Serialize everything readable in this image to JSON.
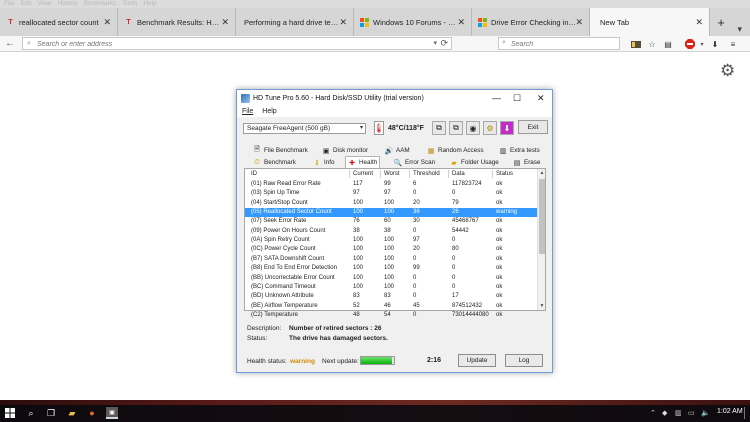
{
  "browser": {
    "menu": [
      "File",
      "Edit",
      "View",
      "History",
      "Bookmarks",
      "Tools",
      "Help"
    ],
    "tabs": [
      {
        "label": "reallocated sector count",
        "favicon": "T",
        "color": "#d9261c"
      },
      {
        "label": "Benchmark Results: HD T...",
        "favicon": "T",
        "color": "#d9261c"
      },
      {
        "label": "Performing a hard drive test w...",
        "favicon": "",
        "color": "#888888"
      },
      {
        "label": "Windows 10 Forums - Sea...",
        "favicon": "win",
        "color": "#1e73be"
      },
      {
        "label": "Drive Error Checking in Wi...",
        "favicon": "win",
        "color": "#1e73be"
      },
      {
        "label": "New Tab",
        "favicon": "",
        "color": "#ffffff"
      }
    ],
    "address_placeholder": "Search or enter address",
    "search_placeholder": "Search"
  },
  "window": {
    "title": "HD Tune Pro 5.60 - Hard Disk/SSD Utility (trial version)",
    "menu": [
      "File",
      "Help"
    ],
    "drive": "Seagate FreeAgent (500 gB)",
    "temperature": "48°C/118°F",
    "exit_label": "Exit",
    "tabs_row1": [
      "File Benchmark",
      "Disk monitor",
      "AAM",
      "Random Access",
      "Extra tests"
    ],
    "tabs_row2": [
      "Benchmark",
      "Info",
      "Health",
      "Error Scan",
      "Folder Usage",
      "Erase"
    ],
    "selected_tab": "Health",
    "table": {
      "headers": [
        "ID",
        "Current",
        "Worst",
        "Threshold",
        "Data",
        "Status"
      ],
      "rows": [
        [
          "(01) Raw Read Error Rate",
          "117",
          "99",
          "6",
          "117823724",
          "ok"
        ],
        [
          "(03) Spin Up Time",
          "97",
          "97",
          "0",
          "0",
          "ok"
        ],
        [
          "(04) Start/Stop Count",
          "100",
          "100",
          "20",
          "79",
          "ok"
        ],
        [
          "(05) Reallocated Sector Count",
          "100",
          "100",
          "36",
          "26",
          "warning"
        ],
        [
          "(07) Seek Error Rate",
          "76",
          "60",
          "30",
          "45468767",
          "ok"
        ],
        [
          "(09) Power On Hours Count",
          "38",
          "38",
          "0",
          "54442",
          "ok"
        ],
        [
          "(0A) Spin Retry Count",
          "100",
          "100",
          "97",
          "0",
          "ok"
        ],
        [
          "(0C) Power Cycle Count",
          "100",
          "100",
          "20",
          "80",
          "ok"
        ],
        [
          "(B7) SATA Downshift Count",
          "100",
          "100",
          "0",
          "0",
          "ok"
        ],
        [
          "(B8) End To End Error Detection",
          "100",
          "100",
          "99",
          "0",
          "ok"
        ],
        [
          "(BB) Uncorrectable Error Count",
          "100",
          "100",
          "0",
          "0",
          "ok"
        ],
        [
          "(BC) Command Timeout",
          "100",
          "100",
          "0",
          "0",
          "ok"
        ],
        [
          "(BD) Unknown Attribute",
          "83",
          "83",
          "0",
          "17",
          "ok"
        ],
        [
          "(BE) Airflow Temperature",
          "52",
          "46",
          "45",
          "874512432",
          "ok"
        ],
        [
          "(C2) Temperature",
          "48",
          "54",
          "0",
          "73014444080",
          "ok"
        ]
      ],
      "selected_row": 3
    },
    "description_label": "Description:",
    "description_value": "Number of retired sectors : 26",
    "status_label": "Status:",
    "status_value": "The drive has damaged sectors.",
    "health_status_label": "Health status:",
    "health_status_value": "warning",
    "next_update_label": "Next update:",
    "next_update_progress": 0.95,
    "next_update_time": "2:16",
    "update_label": "Update",
    "log_label": "Log"
  },
  "taskbar": {
    "clock": "1:02 AM"
  }
}
